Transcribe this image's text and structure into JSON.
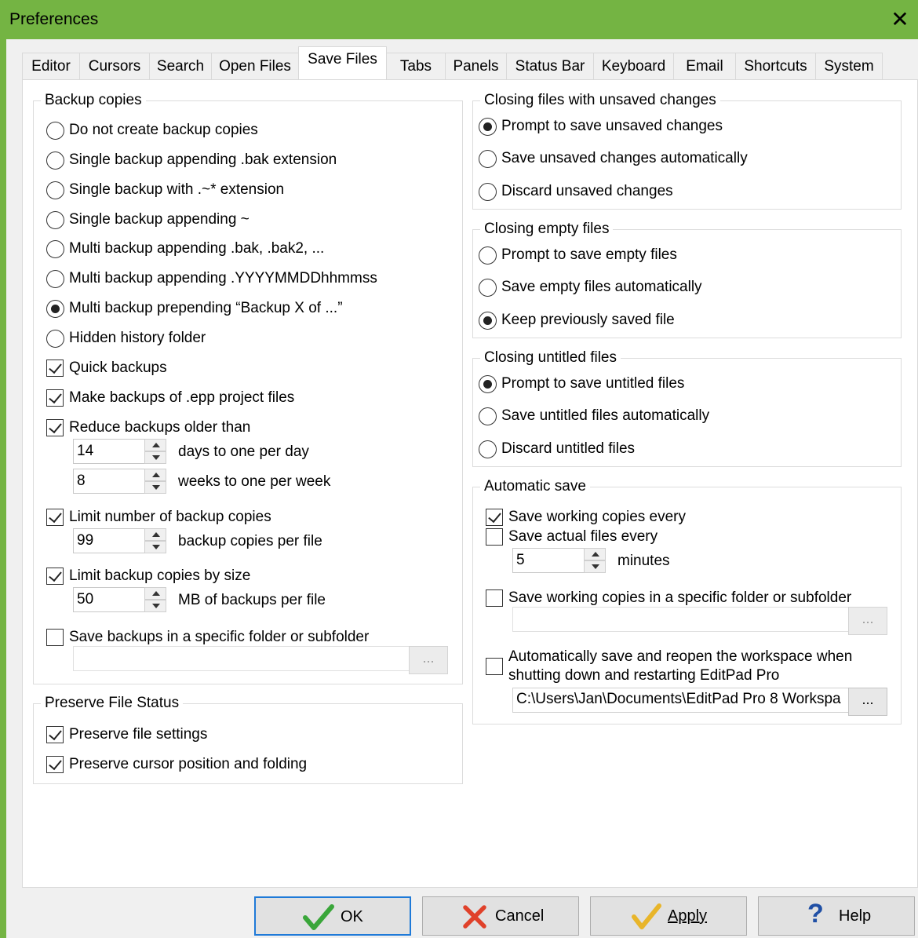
{
  "window": {
    "title": "Preferences",
    "close_glyph": "✕"
  },
  "tabs": [
    {
      "label": "Editor"
    },
    {
      "label": "Cursors"
    },
    {
      "label": "Search"
    },
    {
      "label": "Open Files"
    },
    {
      "label": "Save Files",
      "active": true
    },
    {
      "label": "Tabs"
    },
    {
      "label": "Panels"
    },
    {
      "label": "Status Bar"
    },
    {
      "label": "Keyboard"
    },
    {
      "label": "Email"
    },
    {
      "label": "Shortcuts"
    },
    {
      "label": "System"
    }
  ],
  "backup": {
    "legend": "Backup copies",
    "radios": [
      {
        "label": "Do not create backup copies",
        "selected": false
      },
      {
        "label": "Single backup appending .bak extension",
        "selected": false
      },
      {
        "label": "Single backup with .~* extension",
        "selected": false
      },
      {
        "label": "Single backup appending ~",
        "selected": false
      },
      {
        "label": "Multi backup appending .bak, .bak2, ...",
        "selected": false
      },
      {
        "label": "Multi backup appending .YYYYMMDDhhmmss",
        "selected": false
      },
      {
        "label": "Multi backup prepending “Backup X of ...”",
        "selected": true
      },
      {
        "label": "Hidden history folder",
        "selected": false
      }
    ],
    "quick_backups": "Quick backups",
    "epp_backups": "Make backups of .epp project files",
    "reduce_label": "Reduce backups older than",
    "days_value": "14",
    "days_label": "days to one per day",
    "weeks_value": "8",
    "weeks_label": "weeks to one per week",
    "limit_number_label": "Limit number of backup copies",
    "copies_value": "99",
    "copies_label": "backup copies per file",
    "limit_size_label": "Limit backup copies by size",
    "size_value": "50",
    "size_label": "MB of backups per file",
    "specific_folder_label": "Save backups in a specific folder or subfolder",
    "folder_value": "",
    "browse_label": "..."
  },
  "preserve": {
    "legend": "Preserve File Status",
    "settings_label": "Preserve file settings",
    "cursor_label": "Preserve cursor position and folding"
  },
  "closing_unsaved": {
    "legend": "Closing files with unsaved changes",
    "options": [
      {
        "label": "Prompt to save unsaved changes",
        "selected": true
      },
      {
        "label": "Save unsaved changes automatically",
        "selected": false
      },
      {
        "label": "Discard unsaved changes",
        "selected": false
      }
    ]
  },
  "closing_empty": {
    "legend": "Closing empty files",
    "options": [
      {
        "label": "Prompt to save empty files",
        "selected": false
      },
      {
        "label": "Save empty files automatically",
        "selected": false
      },
      {
        "label": "Keep previously saved file",
        "selected": true
      }
    ]
  },
  "closing_untitled": {
    "legend": "Closing untitled files",
    "options": [
      {
        "label": "Prompt to save untitled files",
        "selected": true
      },
      {
        "label": "Save untitled files automatically",
        "selected": false
      },
      {
        "label": "Discard untitled files",
        "selected": false
      }
    ]
  },
  "autosave": {
    "legend": "Automatic save",
    "working_copies_label": "Save working copies every",
    "actual_files_label": "Save actual files every",
    "minutes_value": "5",
    "minutes_label": "minutes",
    "specific_folder_label": "Save working copies in a specific folder or subfolder",
    "folder_value": "",
    "browse_label": "...",
    "workspace_line1": "Automatically save and reopen the workspace when",
    "workspace_line2": "shutting down and restarting EditPad Pro",
    "workspace_path": "C:\\Users\\Jan\\Documents\\EditPad Pro 8 Workspa",
    "workspace_browse": "..."
  },
  "buttons": {
    "ok": "OK",
    "cancel": "Cancel",
    "apply": "Apply",
    "help": "Help"
  },
  "colors": {
    "titlebar": "#74b443",
    "ok_icon": "#3aa63a",
    "cancel_icon": "#e0412a",
    "apply_icon": "#e8b52a",
    "help_icon": "#1f4fa5",
    "default_border": "#1f7ad8"
  }
}
